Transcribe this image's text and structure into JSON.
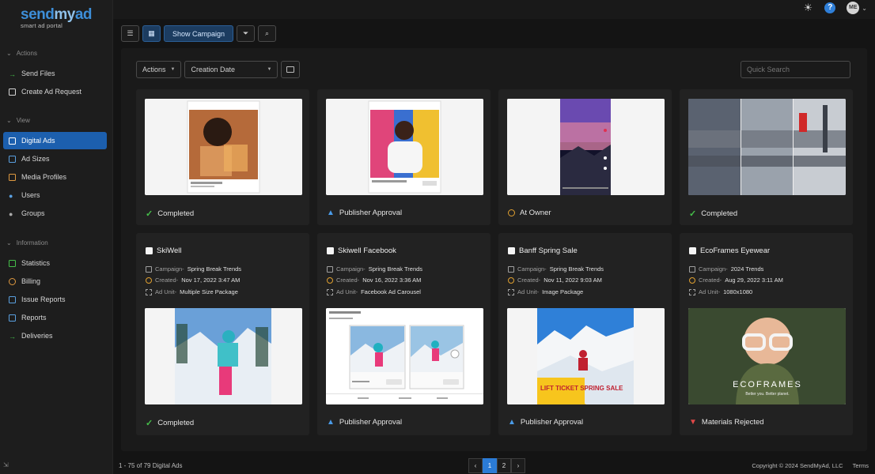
{
  "brand": {
    "logo_main_a": "send",
    "logo_main_b": "my",
    "logo_main_c": "ad",
    "logo_sub": "smart ad portal"
  },
  "sidebar": {
    "sections": [
      {
        "label": "Actions",
        "items": [
          {
            "label": "Send Files",
            "icon": "arrow-right-icon"
          },
          {
            "label": "Create Ad Request",
            "icon": "document-icon"
          }
        ]
      },
      {
        "label": "View",
        "items": [
          {
            "label": "Digital Ads",
            "icon": "image-icon",
            "active": true
          },
          {
            "label": "Ad Sizes",
            "icon": "dimensions-icon"
          },
          {
            "label": "Media Profiles",
            "icon": "profile-card-icon"
          },
          {
            "label": "Users",
            "icon": "user-icon"
          },
          {
            "label": "Groups",
            "icon": "group-icon"
          }
        ]
      },
      {
        "label": "Information",
        "items": [
          {
            "label": "Statistics",
            "icon": "chart-icon"
          },
          {
            "label": "Billing",
            "icon": "billing-icon"
          },
          {
            "label": "Issue Reports",
            "icon": "bookmark-icon"
          },
          {
            "label": "Reports",
            "icon": "bookmark-icon"
          },
          {
            "label": "Deliveries",
            "icon": "arrow-right-icon"
          }
        ]
      }
    ]
  },
  "topbar": {
    "avatar": "ME"
  },
  "toolbar": {
    "show_campaign": "Show Campaign"
  },
  "filters": {
    "actions": "Actions",
    "sort": "Creation Date",
    "quick_search_placeholder": "Quick Search"
  },
  "cards_row1": [
    {
      "status": "Completed",
      "status_type": "completed"
    },
    {
      "status": "Publisher Approval",
      "status_type": "publisher"
    },
    {
      "status": "At Owner",
      "status_type": "owner"
    },
    {
      "status": "Completed",
      "status_type": "completed"
    }
  ],
  "cards_row2": [
    {
      "title": "SkiWell",
      "campaign": "Spring Break Trends",
      "created": "Nov 17, 2022 3:47 AM",
      "ad_unit": "Multiple Size Package",
      "status": "Completed",
      "status_type": "completed"
    },
    {
      "title": "Skiwell Facebook",
      "campaign": "Spring Break Trends",
      "created": "Nov 16, 2022 3:36 AM",
      "ad_unit": "Facebook Ad Carousel",
      "status": "Publisher Approval",
      "status_type": "publisher"
    },
    {
      "title": "Banff Spring Sale",
      "campaign": "Spring Break Trends",
      "created": "Nov 11, 2022 9:03 AM",
      "ad_unit": "Image Package",
      "status": "Publisher Approval",
      "status_type": "publisher"
    },
    {
      "title": "EcoFrames Eyewear",
      "campaign": "2024 Trends",
      "created": "Aug 29, 2022 3:11 AM",
      "ad_unit": "1080x1080",
      "status": "Materials Rejected",
      "status_type": "rejected"
    }
  ],
  "meta_labels": {
    "campaign": "Campaign-",
    "created": "Created-",
    "ad_unit": "Ad Unit-"
  },
  "thumb_text": {
    "lift_ticket": "LIFT TICKET SPRING SALE",
    "ecoframes": "ECOFRAMES",
    "ecoframes_tag": "Better you. Better planet."
  },
  "footer": {
    "count": "1 - 75 of 79 Digital Ads",
    "pages": [
      "1",
      "2"
    ],
    "copyright": "Copyright © 2024 SendMyAd, LLC",
    "terms": "Terms"
  },
  "colors": {
    "accent": "#2b7bd6",
    "completed": "#45c04a",
    "rejected": "#e04848",
    "owner": "#e0a030"
  }
}
